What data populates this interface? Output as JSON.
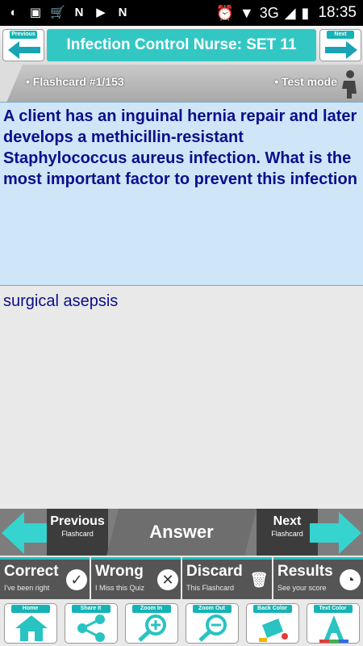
{
  "status_bar": {
    "time": "18:35",
    "network": "3G"
  },
  "header": {
    "title": "Infection Control Nurse: SET 11",
    "previous_tab": "Previous",
    "next_tab": "Next"
  },
  "card": {
    "counter": "• Flashcard #1/153",
    "mode": "• Test mode",
    "question": "A client has an inguinal hernia repair and later develops a methicillin-resistant Staphylococcus aureus infection. What is the most important factor to prevent this infection",
    "answer": "surgical asepsis"
  },
  "nav": {
    "previous": "Previous",
    "previous_sub": "Flashcard",
    "answer": "Answer",
    "next": "Next",
    "next_sub": "Flashcard"
  },
  "actions": [
    {
      "label": "Correct",
      "sub": "I've been right"
    },
    {
      "label": "Wrong",
      "sub": "I Miss this Quiz"
    },
    {
      "label": "Discard",
      "sub": "This Flashcard"
    },
    {
      "label": "Results",
      "sub": "See your score"
    }
  ],
  "tools": [
    {
      "label": "Home"
    },
    {
      "label": "Share It"
    },
    {
      "label": "Zoom In"
    },
    {
      "label": "Zoom Out"
    },
    {
      "label": "Back Color"
    },
    {
      "label": "Text Color"
    }
  ],
  "colors": {
    "accent": "#33c7c4",
    "question_bg": "#cfe6f8",
    "text": "#0b0f8a"
  }
}
